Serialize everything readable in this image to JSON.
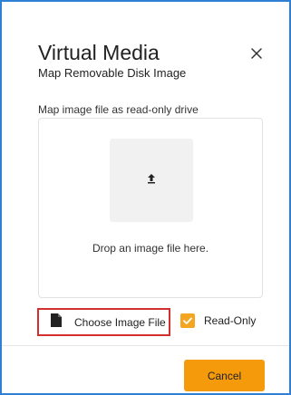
{
  "dialog": {
    "title": "Virtual Media",
    "subtitle": "Map Removable Disk Image",
    "close_icon": "close-icon"
  },
  "drop_area": {
    "label": "Map image file as read-only drive",
    "upload_icon": "upload-icon",
    "text": "Drop an image file here."
  },
  "actions": {
    "choose_file_icon": "file-icon",
    "choose_file_label": "Choose Image File",
    "readonly_label": "Read-Only",
    "readonly_checked": true,
    "cancel_label": "Cancel"
  },
  "colors": {
    "accent": "#f59a0b",
    "checkbox": "#f4a623",
    "highlight_border": "#d32f2f",
    "frame_border": "#2f80d4"
  }
}
